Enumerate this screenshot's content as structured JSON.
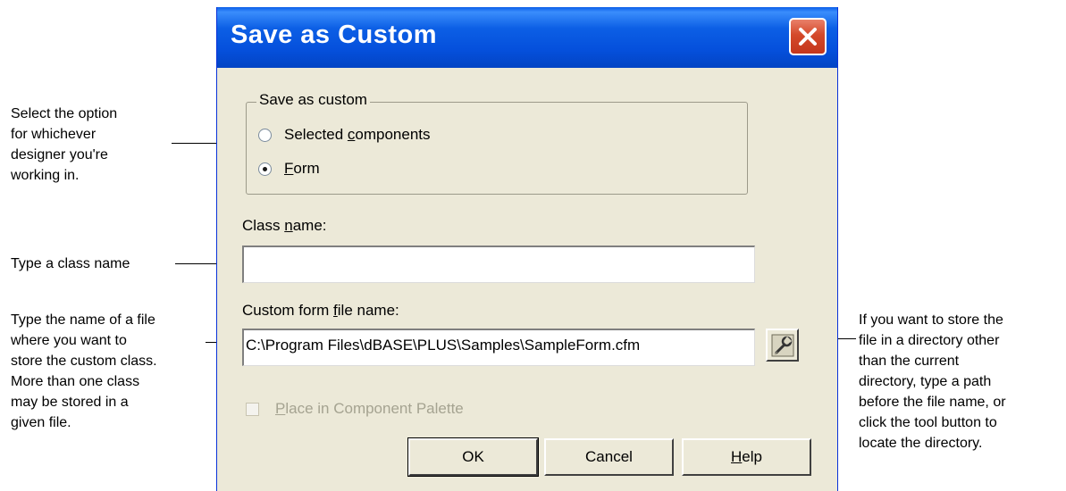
{
  "window": {
    "title": "Save as Custom"
  },
  "group": {
    "legend": "Save as custom",
    "options": [
      {
        "pre": "Selected ",
        "accel": "c",
        "post": "omponents",
        "selected": false
      },
      {
        "pre": "",
        "accel": "F",
        "post": "orm",
        "selected": true
      }
    ]
  },
  "class_name": {
    "pre": "Class ",
    "accel": "n",
    "post": "ame:",
    "value": ""
  },
  "file_name": {
    "pre": "Custom form ",
    "accel": "f",
    "post": "ile name:",
    "value": "C:\\Program Files\\dBASE\\PLUS\\Samples\\SampleForm.cfm"
  },
  "palette": {
    "accel": "P",
    "post": "lace in Component Palette",
    "checked": false,
    "enabled": false
  },
  "buttons": {
    "ok": "OK",
    "cancel": "Cancel",
    "help_accel": "H",
    "help_post": "elp"
  },
  "callouts": {
    "option": [
      "Select the option",
      "for whichever",
      "designer you're",
      "working in."
    ],
    "class": [
      "Type a class name"
    ],
    "file": [
      "Type the name of a file",
      "where you want to",
      "store the custom class.",
      "More than one class",
      "may be stored in a",
      "given file."
    ],
    "tool": [
      "If you want to store the",
      "file in a directory other",
      "than the current",
      "directory, type a path",
      "before the file name, or",
      "click the tool button to",
      "locate the directory."
    ]
  },
  "colors": {
    "dialog_bg": "#ece9d8",
    "titlebar": "#0550dc",
    "close": "#d4492a"
  },
  "icons": {
    "close": "close-icon",
    "tool": "wrench-icon"
  }
}
